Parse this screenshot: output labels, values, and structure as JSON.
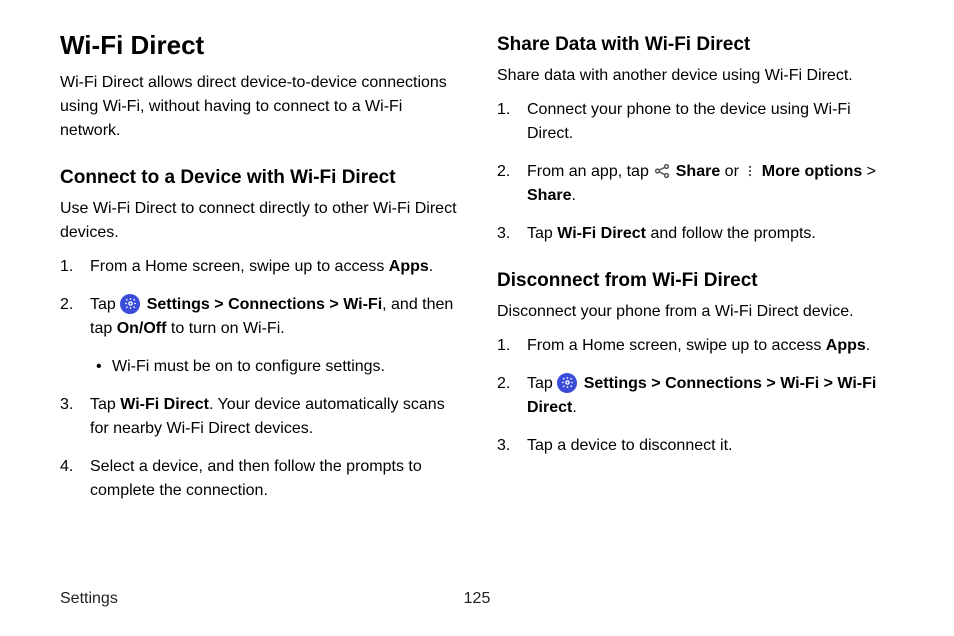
{
  "left": {
    "h1": "Wi-Fi Direct",
    "intro": "Wi-Fi Direct allows direct device-to-device connections using Wi-Fi, without having to connect to a Wi-Fi network.",
    "section1": {
      "heading": "Connect to a Device with Wi-Fi Direct",
      "intro": "Use Wi-Fi Direct to connect directly to other Wi-Fi Direct devices.",
      "step1_a": "From a Home screen, swipe up to access ",
      "step1_b": "Apps",
      "step1_c": ".",
      "step2_a": "Tap ",
      "step2_b": "Settings",
      "step2_c": " > ",
      "step2_d": "Connections",
      "step2_e": " > ",
      "step2_f": "Wi-Fi",
      "step2_g": ", and then tap ",
      "step2_h": "On/Off",
      "step2_i": " to turn on Wi-Fi.",
      "bullet1": "Wi-Fi must be on to configure settings.",
      "step3_a": "Tap ",
      "step3_b": "Wi-Fi Direct",
      "step3_c": ". Your device automatically scans for nearby Wi-Fi Direct devices.",
      "step4": "Select a device, and then follow the prompts to complete the connection."
    }
  },
  "right": {
    "section2": {
      "heading": "Share Data with Wi-Fi Direct",
      "intro": "Share data with another device using Wi-Fi Direct.",
      "step1": "Connect your phone to the device using Wi-Fi Direct.",
      "step2_a": "From an app, tap ",
      "step2_b": "Share",
      "step2_c": " or ",
      "step2_d": "More options",
      "step2_e": " > ",
      "step2_f": "Share",
      "step2_g": ".",
      "step3_a": "Tap ",
      "step3_b": "Wi-Fi Direct",
      "step3_c": " and follow the prompts."
    },
    "section3": {
      "heading": "Disconnect from Wi-Fi Direct",
      "intro": "Disconnect your phone from a Wi-Fi Direct device.",
      "step1_a": "From a Home screen, swipe up to access ",
      "step1_b": "Apps",
      "step1_c": ".",
      "step2_a": "Tap ",
      "step2_b": "Settings",
      "step2_c": " > ",
      "step2_d": "Connections",
      "step2_e": " > ",
      "step2_f": "Wi-Fi",
      "step2_g": " > ",
      "step2_h": "Wi-Fi Direct",
      "step2_i": ".",
      "step3": "Tap a device to disconnect it."
    }
  },
  "footer": {
    "section": "Settings",
    "page": "125"
  }
}
